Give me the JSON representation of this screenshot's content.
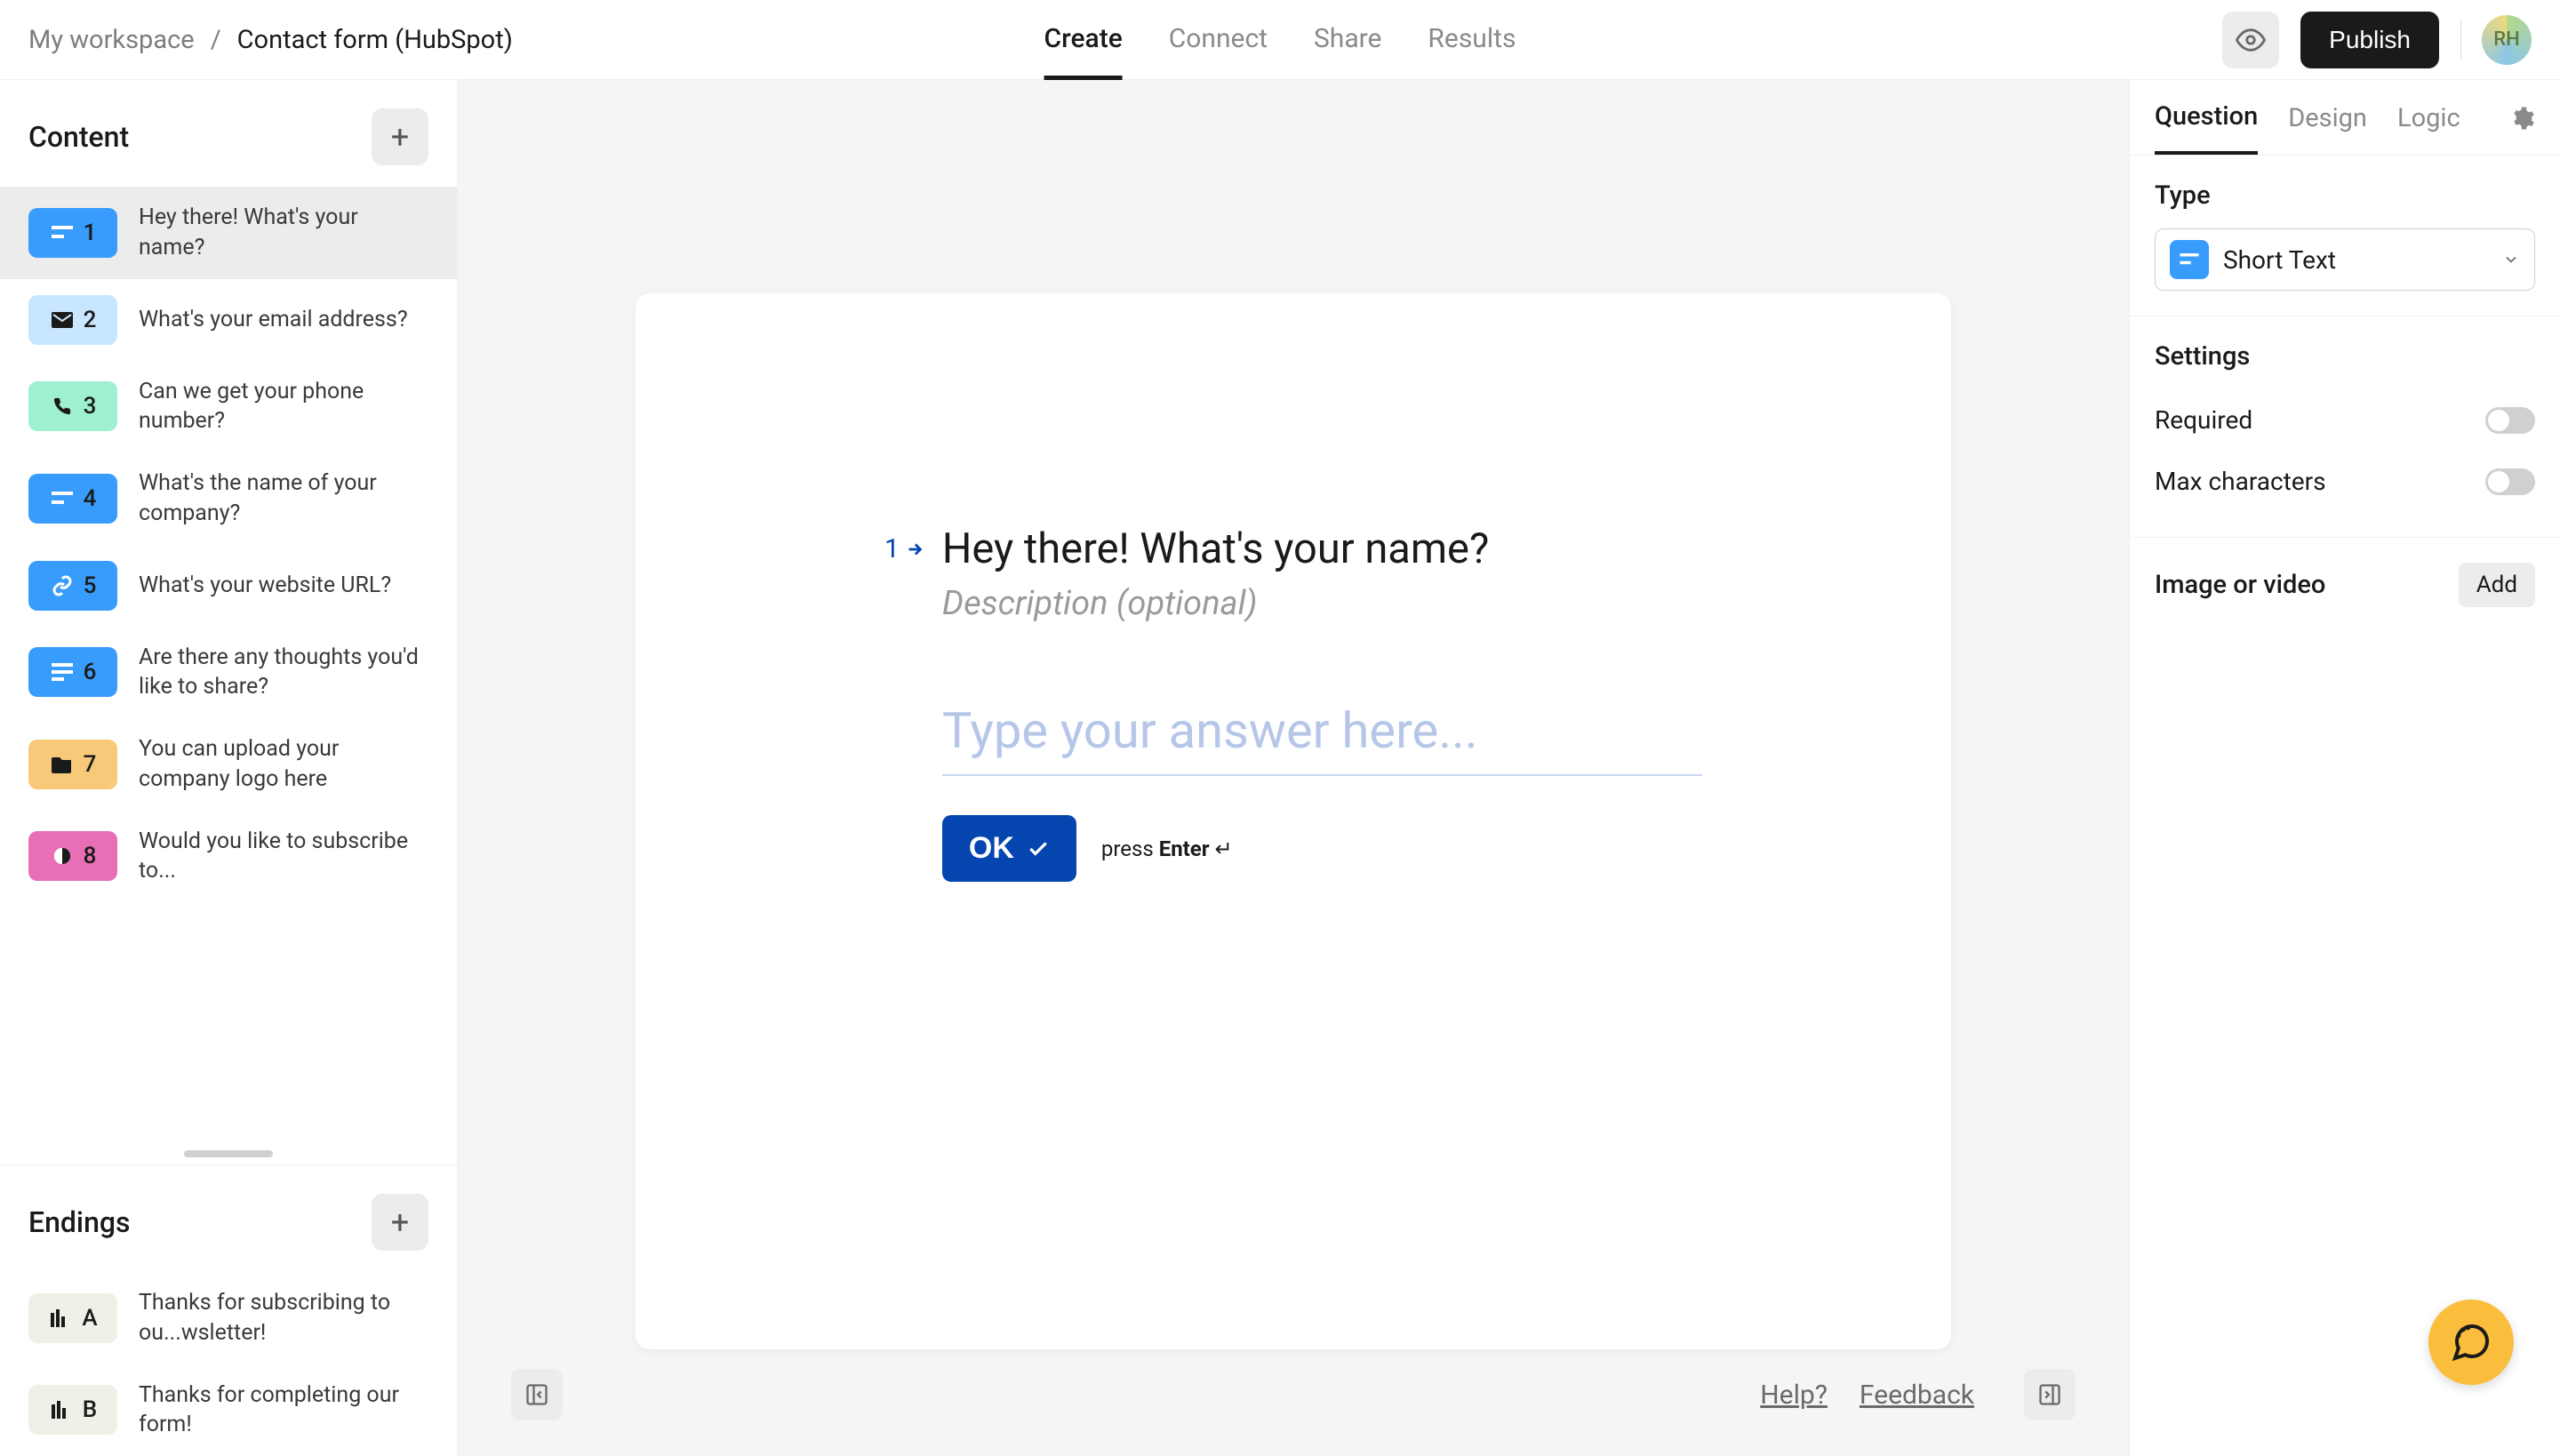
{
  "breadcrumb": {
    "workspace": "My workspace",
    "title": "Contact form (HubSpot)"
  },
  "topnav": {
    "create": "Create",
    "connect": "Connect",
    "share": "Share",
    "results": "Results"
  },
  "publish_label": "Publish",
  "avatar_initials": "RH",
  "sidebar": {
    "content_heading": "Content",
    "items": [
      {
        "num": "1",
        "label": "Hey there! What's your name?",
        "color": "#379cfb",
        "icon": "short-text-icon"
      },
      {
        "num": "2",
        "label": "What's your email address?",
        "color": "#c9e6ff",
        "icon": "email-icon"
      },
      {
        "num": "3",
        "label": "Can we get your phone number?",
        "color": "#9ef0cf",
        "icon": "phone-icon"
      },
      {
        "num": "4",
        "label": "What's the name of your company?",
        "color": "#379cfb",
        "icon": "short-text-icon"
      },
      {
        "num": "5",
        "label": "What's your website URL?",
        "color": "#379cfb",
        "icon": "link-icon"
      },
      {
        "num": "6",
        "label": "Are there any thoughts you'd like to share?",
        "color": "#379cfb",
        "icon": "long-text-icon"
      },
      {
        "num": "7",
        "label": "You can upload your company logo here",
        "color": "#f7c978",
        "icon": "folder-icon"
      },
      {
        "num": "8",
        "label": "Would you like to subscribe to...",
        "color": "#e86fb6",
        "icon": "contrast-icon"
      }
    ],
    "endings_heading": "Endings",
    "endings": [
      {
        "letter": "A",
        "label": "Thanks for subscribing to ou...wsletter!"
      },
      {
        "letter": "B",
        "label": "Thanks for completing our form!"
      }
    ]
  },
  "canvas": {
    "qnum": "1",
    "title": "Hey there! What's your name?",
    "description_placeholder": "Description (optional)",
    "answer_placeholder": "Type your answer here...",
    "ok_label": "OK",
    "press_text": "press ",
    "enter_text": "Enter",
    "footer": {
      "help": "Help?",
      "feedback": "Feedback"
    }
  },
  "rightbar": {
    "tabs": {
      "question": "Question",
      "design": "Design",
      "logic": "Logic"
    },
    "type_heading": "Type",
    "type_value": "Short Text",
    "settings_heading": "Settings",
    "required_label": "Required",
    "maxchars_label": "Max characters",
    "media_heading": "Image or video",
    "add_label": "Add"
  }
}
